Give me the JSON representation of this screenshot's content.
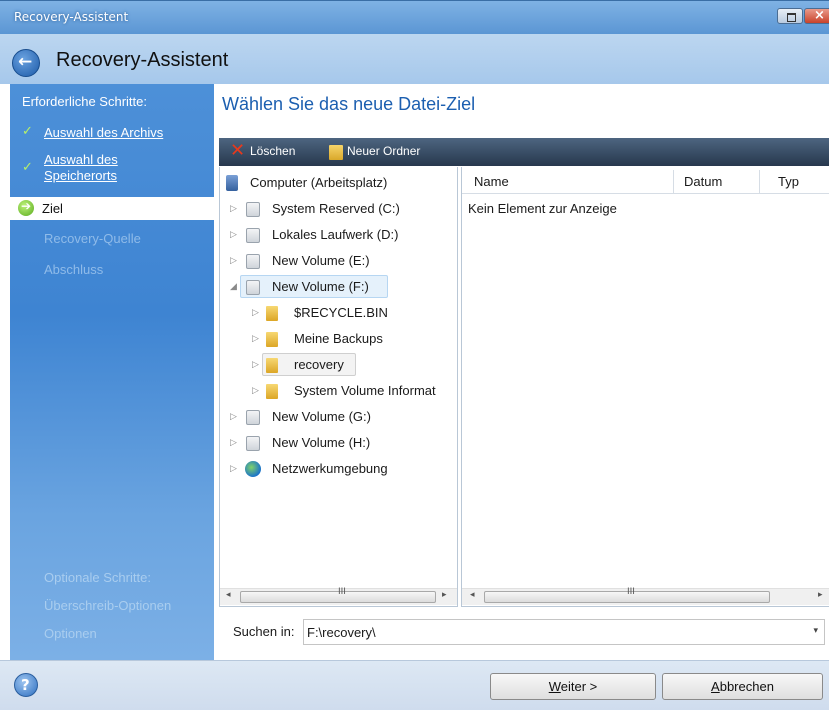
{
  "window": {
    "title": "Recovery-Assistent",
    "close_glyph": "×"
  },
  "header": {
    "title": "Recovery-Assistent",
    "back_glyph": "←"
  },
  "sidebar": {
    "heading": "Erforderliche Schritte:",
    "steps": [
      {
        "label": "Auswahl des Archivs",
        "state": "done"
      },
      {
        "label_line1": "Auswahl des",
        "label_line2": "Speicherorts",
        "state": "done"
      },
      {
        "label": "Ziel",
        "state": "current"
      },
      {
        "label": "Recovery-Quelle",
        "state": "pending"
      },
      {
        "label": "Abschluss",
        "state": "pending"
      }
    ],
    "check_glyph": "✓",
    "current_glyph": "➔",
    "optional_heading": "Optionale Schritte:",
    "optional_items": [
      "Überschreib-Optionen",
      "Optionen"
    ]
  },
  "main": {
    "title": "Wählen Sie das neue Datei-Ziel",
    "toolbar": {
      "delete_label": "Löschen",
      "delete_glyph": "✕",
      "new_folder_label": "Neuer Ordner"
    },
    "tree": {
      "root": "Computer (Arbeitsplatz)",
      "items": [
        {
          "label": "System Reserved (C:)"
        },
        {
          "label": "Lokales Laufwerk (D:)"
        },
        {
          "label": "New Volume (E:)"
        },
        {
          "label": "New Volume (F:)",
          "expanded": true,
          "selected": true,
          "children": [
            "$RECYCLE.BIN",
            "Meine Backups",
            "recovery",
            "System Volume Informat"
          ]
        },
        {
          "label": "New Volume (G:)"
        },
        {
          "label": "New Volume (H:)"
        },
        {
          "label": "Netzwerkumgebung"
        }
      ],
      "tri_collapsed": "▷",
      "tri_expanded": "◢"
    },
    "list": {
      "columns": [
        "Name",
        "Datum",
        "Typ"
      ],
      "empty_text": "Kein Element zur Anzeige"
    },
    "scroll": {
      "thumb_glyph": "III",
      "left_glyph": "◂",
      "right_glyph": "▸"
    },
    "search": {
      "label": "Suchen in:",
      "value": "F:\\recovery\\",
      "dropdown_glyph": "▾"
    }
  },
  "footer": {
    "help_glyph": "?",
    "next_label": "Weiter >",
    "next_underline": "W",
    "next_rest": "eiter >",
    "cancel_underline": "A",
    "cancel_rest": "bbrechen"
  },
  "colors": {
    "sidebar": "#4d90d8",
    "title_accent": "#1c5fb0",
    "toolbar": "#27384d",
    "check": "#b6f06a",
    "delete": "#e8391c"
  }
}
